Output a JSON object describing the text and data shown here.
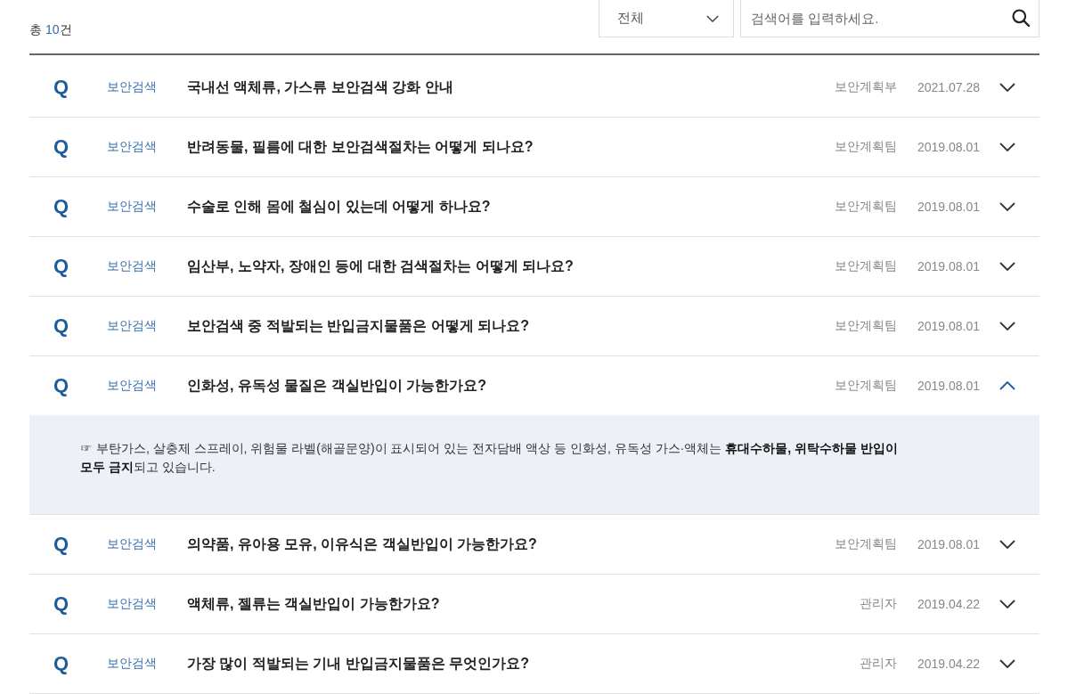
{
  "summary": {
    "label": "총",
    "count": "10",
    "unit": "건"
  },
  "filter": {
    "value": "전체"
  },
  "search": {
    "placeholder": "검색어를 입력하세요."
  },
  "faq_items": [
    {
      "marker": "Q",
      "category": "보안검색",
      "title": "국내선 액체류, 가스류 보안검색 강화 안내",
      "author": "보안계획부",
      "date": "2021.07.28",
      "expanded": false
    },
    {
      "marker": "Q",
      "category": "보안검색",
      "title": "반려동물, 필름에 대한 보안검색절차는 어떻게 되나요?",
      "author": "보안계획팀",
      "date": "2019.08.01",
      "expanded": false
    },
    {
      "marker": "Q",
      "category": "보안검색",
      "title": "수술로 인해 몸에 철심이 있는데 어떻게 하나요?",
      "author": "보안계획팀",
      "date": "2019.08.01",
      "expanded": false
    },
    {
      "marker": "Q",
      "category": "보안검색",
      "title": "임산부, 노약자, 장애인 등에 대한 검색절차는 어떻게 되나요?",
      "author": "보안계획팀",
      "date": "2019.08.01",
      "expanded": false
    },
    {
      "marker": "Q",
      "category": "보안검색",
      "title": "보안검색 중 적발되는 반입금지물품은 어떻게 되나요?",
      "author": "보안계획팀",
      "date": "2019.08.01",
      "expanded": false
    },
    {
      "marker": "Q",
      "category": "보안검색",
      "title": "인화성, 유독성 물질은 객실반입이 가능한가요?",
      "author": "보안계획팀",
      "date": "2019.08.01",
      "expanded": true,
      "answer": "☞ 부탄가스, 살충제 스프레이, 위험물 라벨(해골문양)이 표시되어 있는 전자담배 액상 등 인화성, 유독성 가스·액체는 **휴대수하물, 위탁수하물 반입이 모두 금지**되고 있습니다."
    },
    {
      "marker": "Q",
      "category": "보안검색",
      "title": "의약품, 유아용 모유, 이유식은 객실반입이 가능한가요?",
      "author": "보안계획팀",
      "date": "2019.08.01",
      "expanded": false
    },
    {
      "marker": "Q",
      "category": "보안검색",
      "title": "액체류, 젤류는 객실반입이 가능한가요?",
      "author": "관리자",
      "date": "2019.04.22",
      "expanded": false
    },
    {
      "marker": "Q",
      "category": "보안검색",
      "title": "가장 많이 적발되는 기내 반입금지물품은 무엇인가요?",
      "author": "관리자",
      "date": "2019.04.22",
      "expanded": false
    }
  ]
}
